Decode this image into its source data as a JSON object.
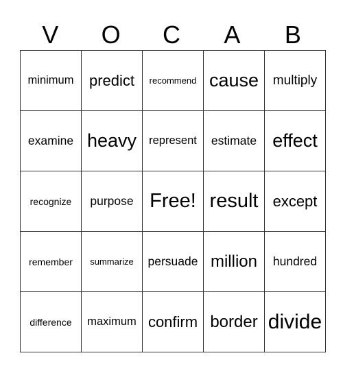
{
  "title_letters": [
    "V",
    "O",
    "C",
    "A",
    "B"
  ],
  "rows": [
    [
      "minimum",
      "predict",
      "recommend",
      "cause",
      "multiply"
    ],
    [
      "examine",
      "heavy",
      "represent",
      "estimate",
      "effect"
    ],
    [
      "recognize",
      "purpose",
      "Free!",
      "result",
      "except"
    ],
    [
      "remember",
      "summarize",
      "persuade",
      "million",
      "hundred"
    ],
    [
      "difference",
      "maximum",
      "confirm",
      "border",
      "divide"
    ]
  ]
}
